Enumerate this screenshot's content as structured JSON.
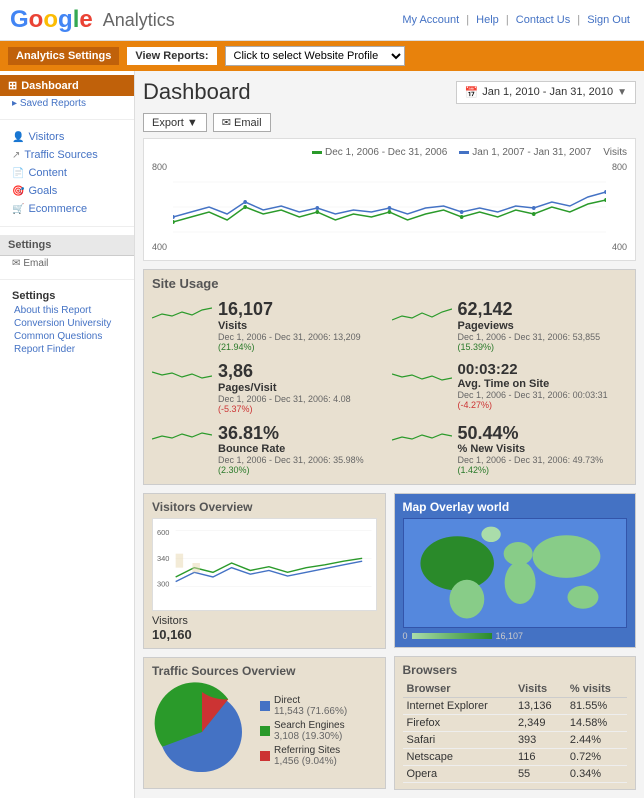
{
  "header": {
    "logo_google": "Google",
    "logo_analytics": "Analytics",
    "nav_my_account": "My Account",
    "nav_help": "Help",
    "nav_contact_us": "Contact Us",
    "nav_sign_out": "Sign Out"
  },
  "topbar": {
    "analytics_settings": "Analytics Settings",
    "view_reports": "View Reports:",
    "website_profile_placeholder": "Click to select Website Profile"
  },
  "sidebar": {
    "dashboard_label": "Dashboard",
    "saved_reports": "Saved Reports",
    "items": [
      {
        "label": "Visitors",
        "icon": "person"
      },
      {
        "label": "Traffic Sources",
        "icon": "arrow"
      },
      {
        "label": "Content",
        "icon": "page"
      },
      {
        "label": "Goals",
        "icon": "target"
      },
      {
        "label": "Ecommerce",
        "icon": "cart"
      }
    ],
    "settings_label": "Settings",
    "settings_email": "Email",
    "settings_items": [
      "About this Report",
      "Conversion University",
      "Common Questions",
      "Report Finder"
    ]
  },
  "dashboard": {
    "title": "Dashboard",
    "date_range": "Jan 1, 2010 - Jan 31, 2010",
    "date_arrow": "▼",
    "export_label": "Export ▼",
    "email_label": "✉ Email"
  },
  "chart_legend": {
    "item1": "Dec 1, 2006 - Dec 31, 2006",
    "item2": "Jan 1, 2007 - Jan 31, 2007",
    "item3": "Visits"
  },
  "chart_y_labels": [
    "800",
    "400"
  ],
  "site_usage": {
    "title": "Site Usage",
    "metrics": [
      {
        "value": "16,107",
        "label": "Visits",
        "sub": "Dec 1, 2006 - Dec 31, 2006: 13,209",
        "change": "(21.94%)",
        "change_type": "green"
      },
      {
        "value": "62,142",
        "label": "Pageviews",
        "sub": "Dec 1, 2006 - Dec 31, 2006: 53,855",
        "change": "(15.39%)",
        "change_type": "green"
      },
      {
        "value": "3,86",
        "label": "Pages/Visit",
        "sub": "Dec 1, 2006 - Dec 31, 2006: 4.08",
        "change": "(-5.37%)",
        "change_type": "red"
      },
      {
        "value": "00:03:22",
        "label": "Avg. Time on Site",
        "sub": "Dec 1, 2006 - Dec 31, 2006: 00:03:31",
        "change": "(-4.27%)",
        "change_type": "red"
      },
      {
        "value": "36.81%",
        "label": "Bounce Rate",
        "sub": "Dec 1, 2006 - Dec 31, 2006: 35.98%",
        "change": "(2.30%)",
        "change_type": "green"
      },
      {
        "value": "50.44%",
        "label": "% New Visits",
        "sub": "Dec 1, 2006 - Dec 31, 2006: 49.73%",
        "change": "(1.42%)",
        "change_type": "green"
      }
    ]
  },
  "visitors_overview": {
    "title": "Visitors Overview",
    "y_labels": [
      "600",
      "340",
      "300"
    ],
    "visitors_label": "Visitors",
    "visitors_count": "10,160"
  },
  "map": {
    "title": "Map Overlay world"
  },
  "traffic_sources": {
    "title": "Traffic Sources Overview",
    "items": [
      {
        "label": "Direct",
        "sub": "11,543 (71.66%)",
        "color": "#4472C4"
      },
      {
        "label": "Search Engines",
        "sub": "3,108 (19.30%)",
        "color": "#2a9a2a"
      },
      {
        "label": "Referring Sites",
        "sub": "1,456 (9.04%)",
        "color": "#cc3333"
      }
    ]
  },
  "browsers": {
    "title": "Browsers",
    "headers": [
      "Browser",
      "Visits",
      "% visits"
    ],
    "rows": [
      {
        "browser": "Internet Explorer",
        "visits": "13,136",
        "pct": "81.55%"
      },
      {
        "browser": "Firefox",
        "visits": "2,349",
        "pct": "14.58%"
      },
      {
        "browser": "Safari",
        "visits": "393",
        "pct": "2.44%"
      },
      {
        "browser": "Netscape",
        "visits": "116",
        "pct": "0.72%"
      },
      {
        "browser": "Opera",
        "visits": "55",
        "pct": "0.34%"
      }
    ]
  }
}
